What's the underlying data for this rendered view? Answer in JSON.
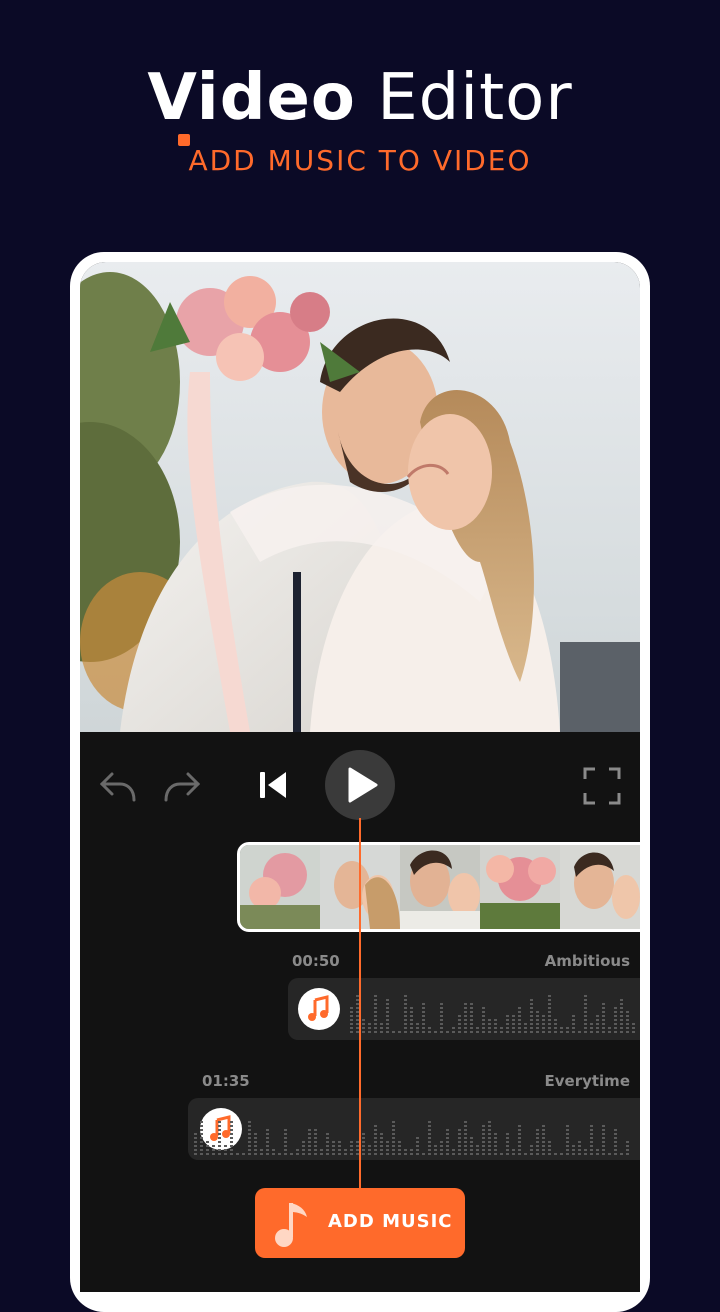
{
  "header": {
    "title_bold": "Video",
    "title_light": "Editor",
    "subtitle": "ADD MUSIC TO VIDEO"
  },
  "colors": {
    "background": "#0b0a26",
    "accent": "#ff6a2b",
    "panel": "#121212",
    "track": "#262626"
  },
  "controls": {
    "icons": [
      "undo-icon",
      "redo-icon",
      "skip-back-icon",
      "play-icon",
      "fullscreen-icon"
    ]
  },
  "tracks": [
    {
      "time": "00:50",
      "name": "Ambitious"
    },
    {
      "time": "01:35",
      "name": "Everytime"
    }
  ],
  "add_music": {
    "label": "ADD MUSIC"
  }
}
